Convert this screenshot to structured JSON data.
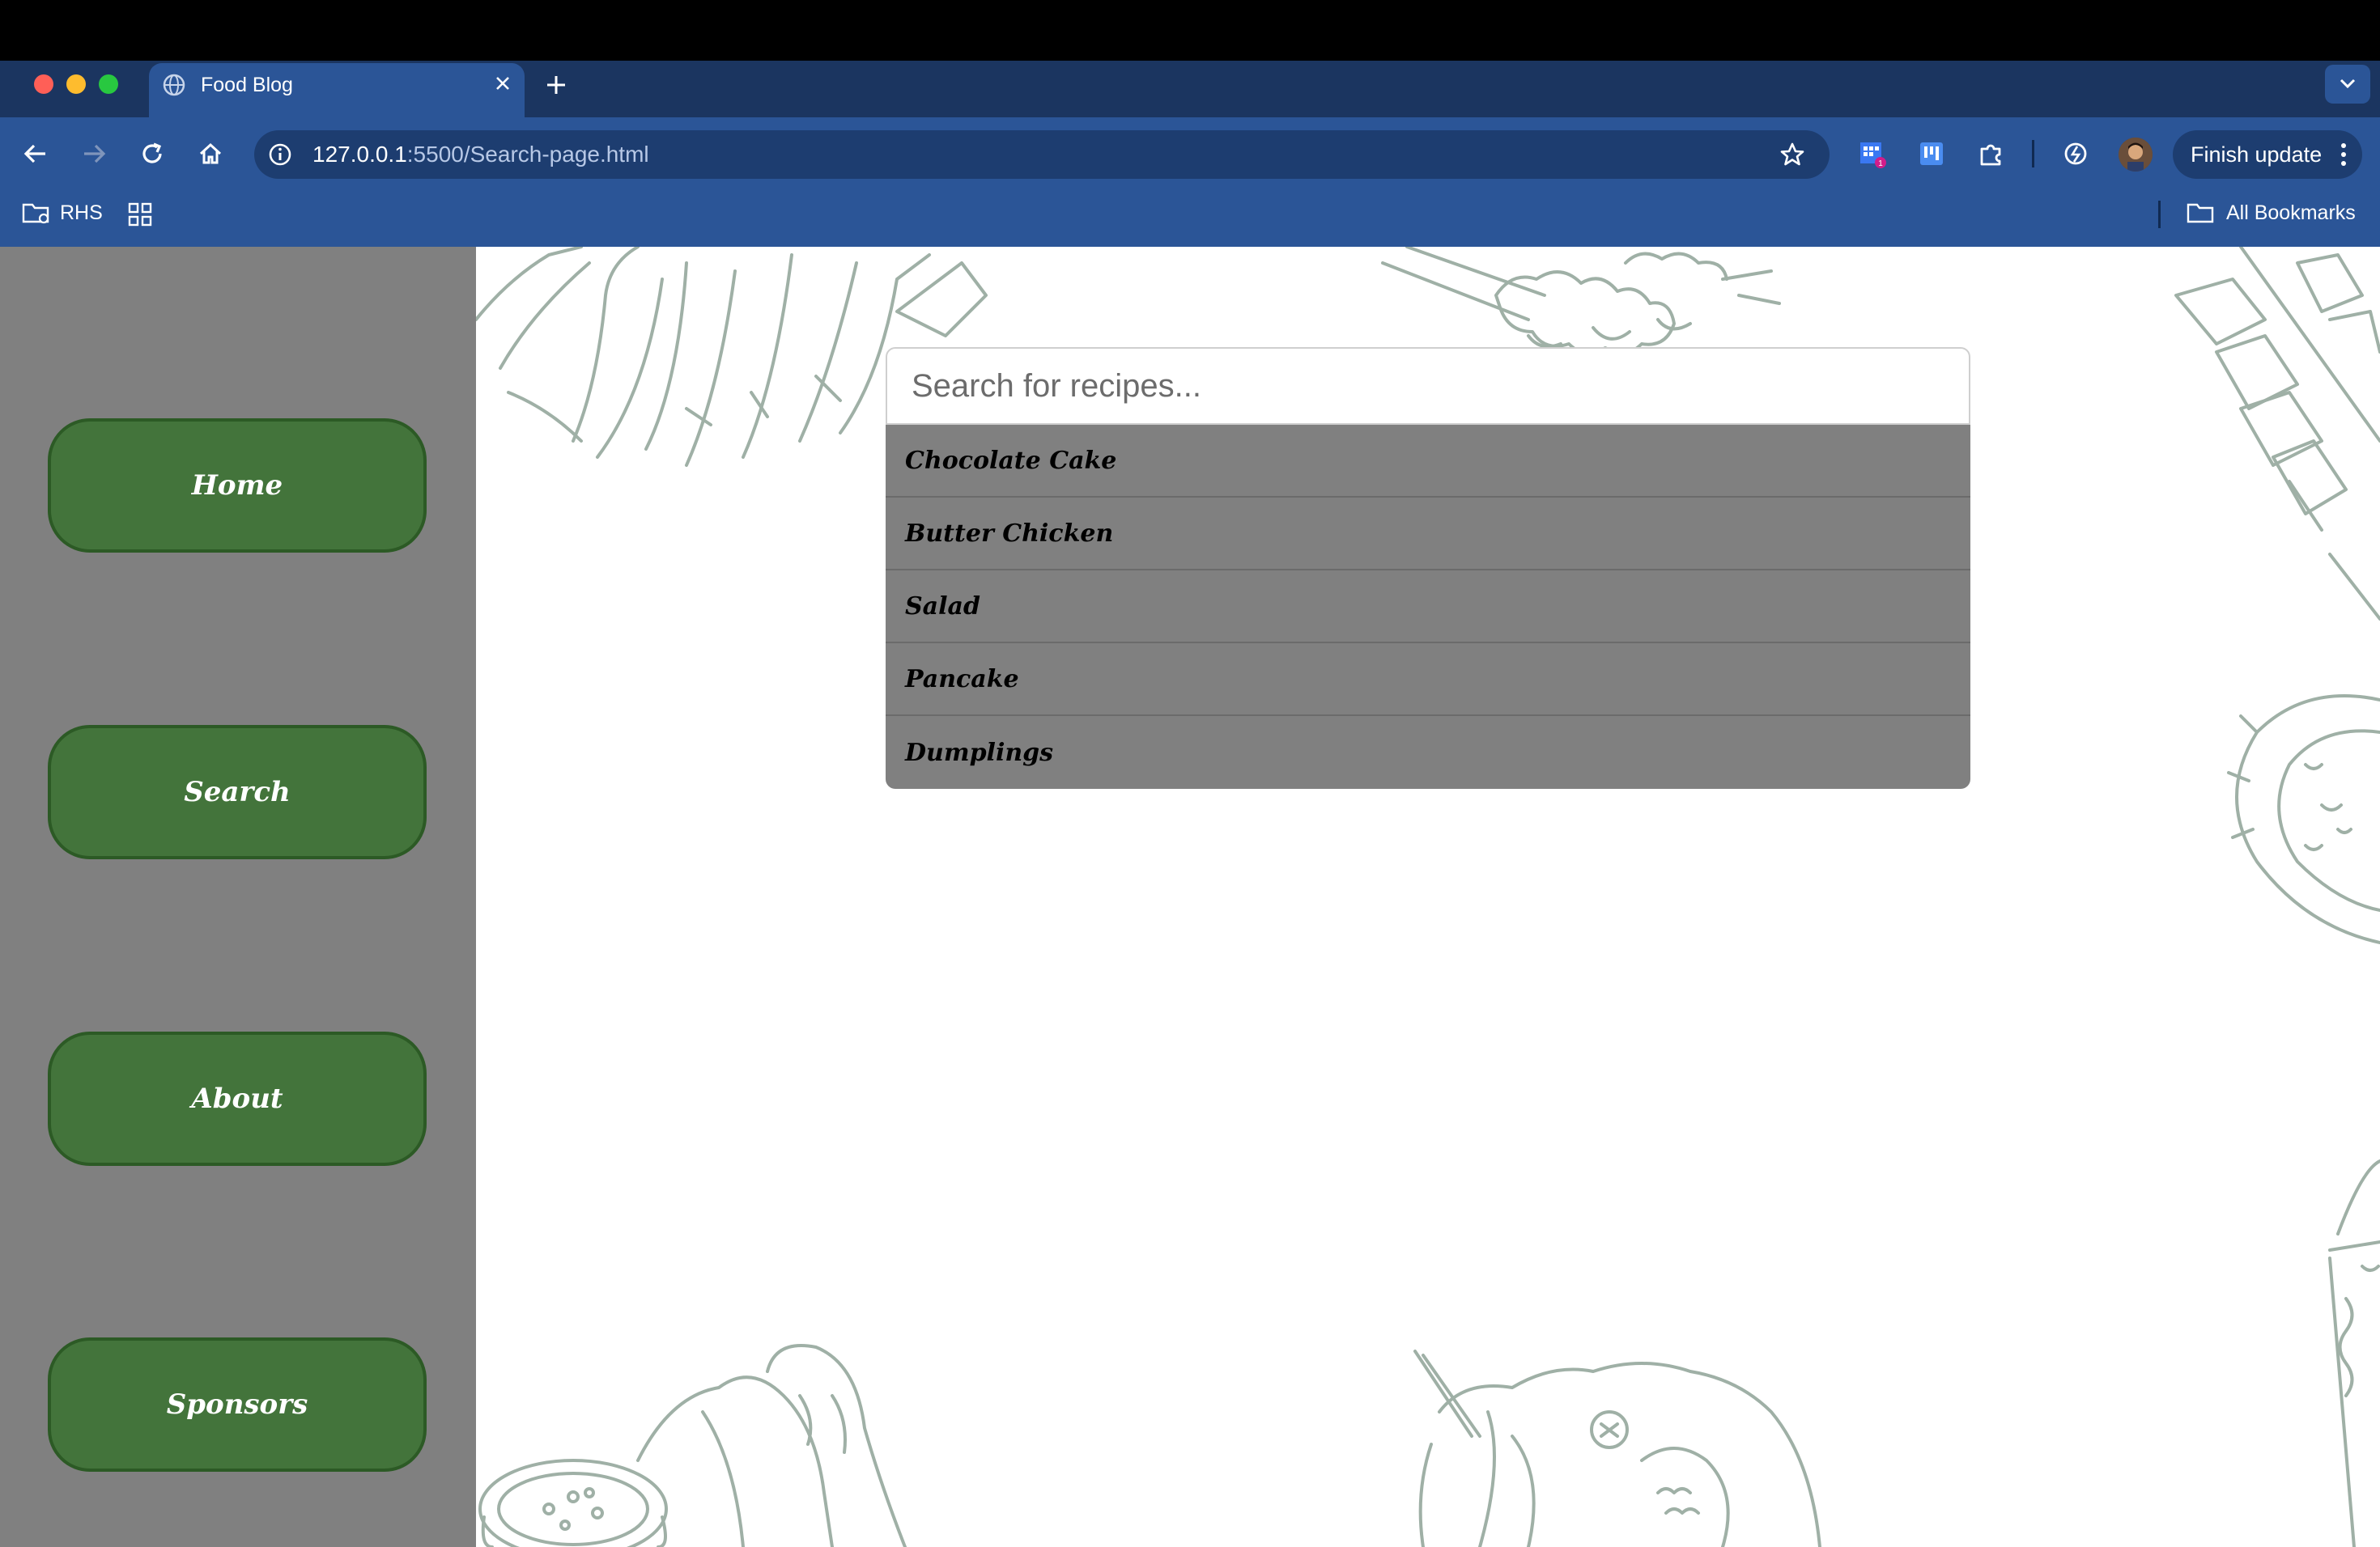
{
  "browser": {
    "tab": {
      "title": "Food Blog"
    },
    "address_bar": {
      "host": "127.0.0.1",
      "path": ":5500/Search-page.html"
    },
    "update_button": {
      "label": "Finish update"
    },
    "bookmarks": {
      "folder": "RHS",
      "all_bookmarks": "All Bookmarks"
    },
    "extension_badge": "1"
  },
  "sidebar": {
    "items": [
      {
        "label": "Home"
      },
      {
        "label": "Search"
      },
      {
        "label": "About"
      },
      {
        "label": "Sponsors"
      }
    ]
  },
  "search": {
    "placeholder": "Search for recipes...",
    "results": [
      {
        "label": "Chocolate Cake"
      },
      {
        "label": "Butter Chicken"
      },
      {
        "label": "Salad"
      },
      {
        "label": "Pancake"
      },
      {
        "label": "Dumplings"
      }
    ]
  },
  "colors": {
    "sidebar_bg": "#808080",
    "nav_button": "#43743b",
    "chrome_toolbar": "#2b5597",
    "chrome_tabstrip": "#1b3560",
    "doodle_stroke": "#9fb0a6"
  }
}
